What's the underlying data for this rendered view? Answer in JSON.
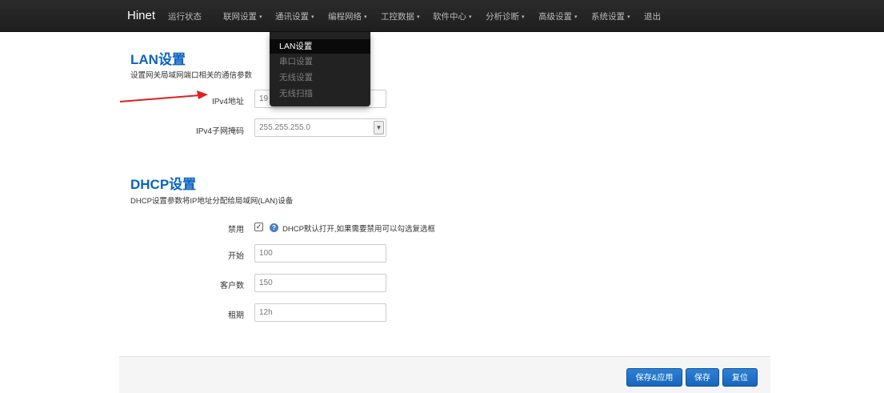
{
  "navbar": {
    "brand": "Hinet",
    "items": [
      {
        "label": "运行状态",
        "has_caret": false
      },
      {
        "label": "联网设置",
        "has_caret": true
      },
      {
        "label": "通讯设置",
        "has_caret": true
      },
      {
        "label": "编程网络",
        "has_caret": true
      },
      {
        "label": "工控数据",
        "has_caret": true
      },
      {
        "label": "软件中心",
        "has_caret": true
      },
      {
        "label": "分析诊断",
        "has_caret": true
      },
      {
        "label": "高级设置",
        "has_caret": true
      },
      {
        "label": "系统设置",
        "has_caret": true
      },
      {
        "label": "退出",
        "has_caret": false
      }
    ],
    "caret": "▾"
  },
  "dropdown": {
    "items": [
      {
        "label": "LAN设置",
        "active": true
      },
      {
        "label": "串口设置",
        "active": false
      },
      {
        "label": "无线设置",
        "active": false
      },
      {
        "label": "无线扫描",
        "active": false
      }
    ]
  },
  "lan": {
    "title": "LAN设置",
    "description": "设置网关局域网端口相关的通信参数",
    "ipv4_label": "IPv4地址",
    "ipv4_value": "19",
    "netmask_label": "IPv4子网掩码",
    "netmask_value": "255.255.255.0"
  },
  "dhcp": {
    "title": "DHCP设置",
    "description": "DHCP设置参数将IP地址分配给局域网(LAN)设备",
    "disable_label": "禁用",
    "disable_checked": true,
    "disable_help": "DHCP默认打开,如果需要禁用可以勾选复选框",
    "start_label": "开始",
    "start_value": "100",
    "clients_label": "客户数",
    "clients_value": "150",
    "lease_label": "租期",
    "lease_value": "12h"
  },
  "buttons": {
    "save_apply": "保存&应用",
    "save": "保存",
    "reset": "复位"
  },
  "icons": {
    "checkbox": "check-icon",
    "help": "info-icon",
    "select": "chevron-down-icon",
    "annotation": "red-arrow"
  },
  "colors": {
    "accent": "#0b63c0",
    "button": "#1f73c6",
    "arrow": "#e02020"
  }
}
